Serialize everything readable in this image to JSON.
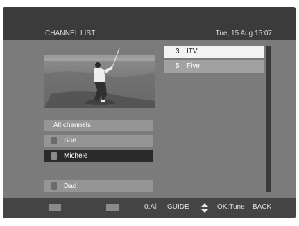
{
  "header": {
    "title": "CHANNEL LIST",
    "datetime": "Tue, 15 Aug 15:07"
  },
  "groups": [
    {
      "label": "All channels",
      "icon": "",
      "selected": false
    },
    {
      "label": "Sue",
      "icon": "user-icon",
      "selected": false
    },
    {
      "label": "Michele",
      "icon": "user-icon",
      "selected": true
    },
    {
      "label": "Dad",
      "icon": "user-icon",
      "selected": false
    }
  ],
  "channels": [
    {
      "number": "3",
      "name": "ITV",
      "highlighted": true
    },
    {
      "number": "5",
      "name": "Five",
      "highlighted": false
    }
  ],
  "footer": {
    "red_key": "red-key-icon",
    "green_key": "green-key-icon",
    "all_label": "0:All",
    "guide_label": "GUIDE",
    "updown_icon": "up-down-arrow-icon",
    "ok_label": "OK:Tune",
    "back_label": "BACK"
  },
  "preview": {
    "icon": "golfer-video-preview"
  }
}
